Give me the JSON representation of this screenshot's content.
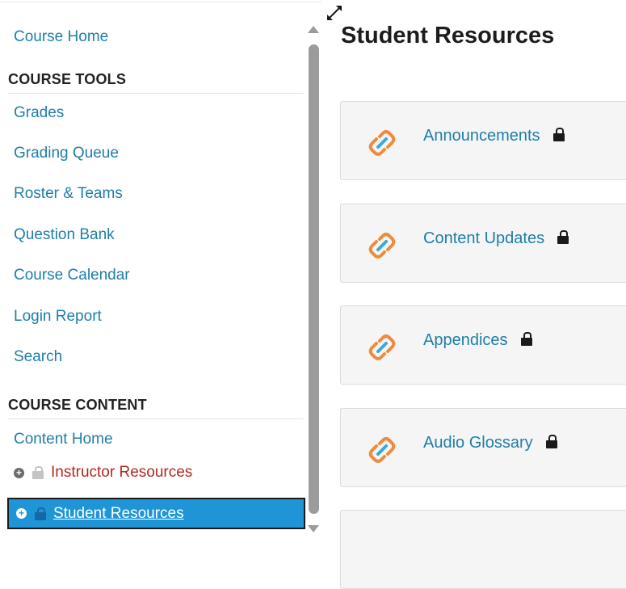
{
  "sidebar": {
    "course_home": "Course Home",
    "tools_heading": "COURSE TOOLS",
    "tools": [
      "Grades",
      "Grading Queue",
      "Roster & Teams",
      "Question Bank",
      "Course Calendar",
      "Login Report",
      "Search"
    ],
    "content_heading": "COURSE CONTENT",
    "content_home": "Content Home",
    "tree": [
      {
        "label": "Instructor Resources",
        "icon": "plus-circle-icon",
        "lock": "lock-icon",
        "selected": false,
        "color": "#b5271f"
      },
      {
        "label": "Student Resources",
        "icon": "plus-circle-icon",
        "lock": "lock-icon",
        "selected": true,
        "color": "#1f95d8"
      }
    ]
  },
  "main": {
    "title": "Student Resources",
    "cards": [
      {
        "title": "Announcements",
        "icon": "link-icon",
        "locked": true
      },
      {
        "title": "Content Updates",
        "icon": "link-icon",
        "locked": true
      },
      {
        "title": "Appendices",
        "icon": "link-icon",
        "locked": true
      },
      {
        "title": "Audio Glossary",
        "icon": "link-icon",
        "locked": true
      }
    ]
  },
  "colors": {
    "link": "#1f7ea8",
    "selected_bg": "#1f95d8",
    "instructor_text": "#b5271f",
    "chain_orange": "#f08a3c",
    "chain_blue": "#3aa9d8"
  }
}
